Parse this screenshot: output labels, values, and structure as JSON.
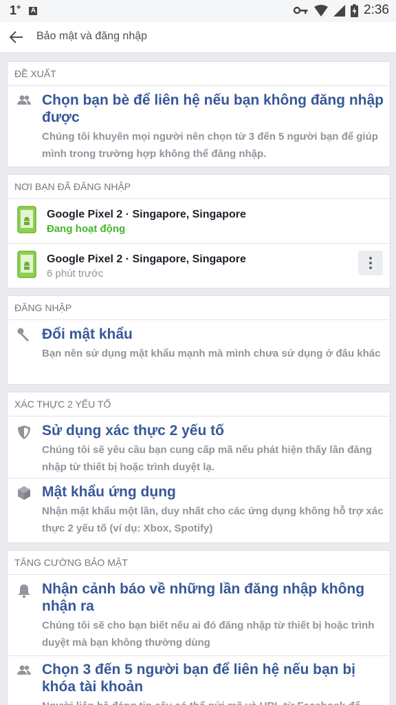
{
  "status_bar": {
    "signal_label": "1",
    "signal_sup": "+",
    "notif_letter": "A",
    "battery_icon": "battery-charging-icon",
    "time": "2:36"
  },
  "header": {
    "title": "Bảo mật và đăng nhập",
    "back_icon": "arrow-back-icon"
  },
  "sections": {
    "suggested": {
      "header": "ĐỀ XUẤT",
      "item": {
        "title": "Chọn bạn bè để liên hệ nếu bạn không đăng nhập được",
        "desc": "Chúng tôi khuyên mọi người nên chọn từ 3 đến 5 người bạn để giúp mình trong trường hợp không thể đăng nhập.",
        "icon": "friends-icon"
      }
    },
    "where_logged_in": {
      "header": "NƠI BẠN ĐÃ ĐĂNG NHẬP",
      "devices": [
        {
          "name": "Google Pixel 2 · Singapore, Singapore",
          "status": "Đang hoạt động",
          "icon": "android-phone-icon"
        },
        {
          "name": "Google Pixel 2 · Singapore, Singapore",
          "status": "6 phút trước",
          "icon": "android-phone-icon"
        }
      ]
    },
    "login": {
      "header": "ĐĂNG NHẬP",
      "item": {
        "title": "Đổi mật khẩu",
        "desc": "Bạn nên sử dụng mật khẩu mạnh mà mình chưa sử dụng ở đâu khác",
        "icon": "key-icon"
      }
    },
    "two_factor": {
      "header": "XÁC THỰC 2 YẾU TỐ",
      "items": [
        {
          "title": "Sử dụng xác thực 2 yếu tố",
          "desc": "Chúng tôi sẽ yêu cầu bạn cung cấp mã nếu phát hiện thấy lần đăng nhập từ thiết bị hoặc trình duyệt lạ.",
          "icon": "shield-icon"
        },
        {
          "title": "Mật khẩu ứng dụng",
          "desc": "Nhận mật khẩu một lần, duy nhất cho các ứng dụng không hỗ trợ xác thực 2 yếu tố (ví dụ: Xbox, Spotify)",
          "icon": "cube-icon"
        }
      ]
    },
    "extra": {
      "header": "TĂNG CƯỜNG BẢO MẬT",
      "items": [
        {
          "title": "Nhận cảnh báo về những lần đăng nhập không nhận ra",
          "desc": "Chúng tôi sẽ cho bạn biết nếu ai đó đăng nhập từ thiết bị hoặc trình duyệt mà bạn không thường dùng",
          "icon": "bell-icon"
        },
        {
          "title": "Chọn 3 đến 5 người bạn để liên hệ nếu bạn bị khóa tài khoản",
          "desc": "Người liên hệ đáng tin cậy có thể gửi mã và URL từ Facebook để",
          "icon": "friends-icon"
        }
      ]
    }
  }
}
